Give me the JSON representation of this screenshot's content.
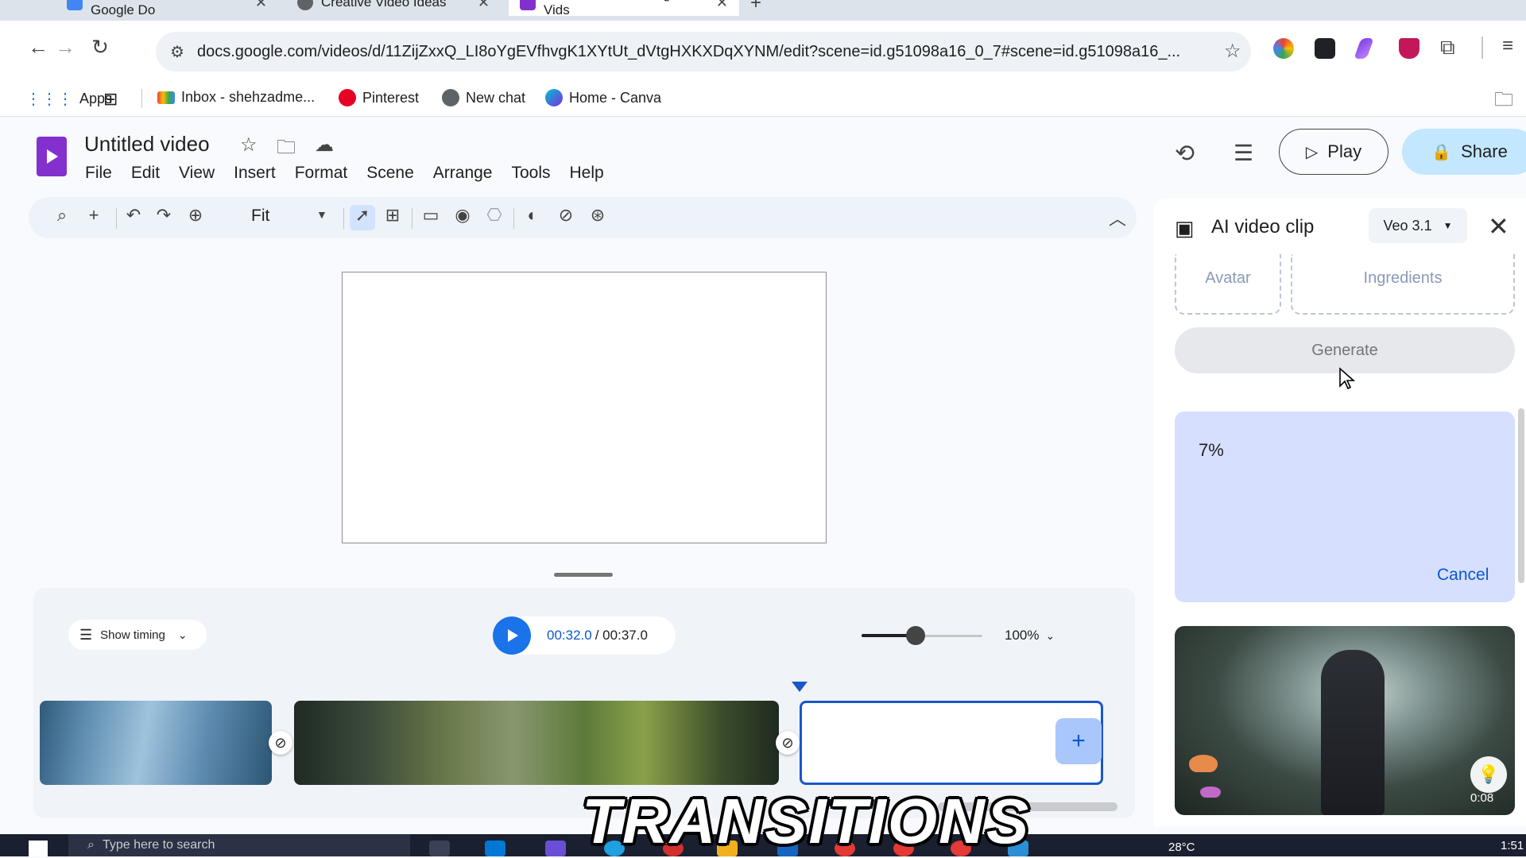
{
  "browser": {
    "tabs": [
      {
        "label": "Untitled document - Google Do",
        "color": "#4285f4"
      },
      {
        "label": "Creative Video Ideas",
        "color": "#5f6368"
      },
      {
        "label": "Untitled video - Google Vids",
        "color": "#8430ce"
      }
    ],
    "url": "docs.google.com/videos/d/11ZijZxxQ_LI8oYgEVfhvgK1XYtUt_dVtgHXKXDqXYNM/edit?scene=id.g51098a16_0_7#scene=id.g51098a16_...",
    "bookmarks": [
      "Apps",
      "Inbox - shehzadme...",
      "Pinterest",
      "New chat",
      "Home - Canva"
    ]
  },
  "app": {
    "doc_title": "Untitled video",
    "menu": [
      "File",
      "Edit",
      "View",
      "Insert",
      "Format",
      "Scene",
      "Arrange",
      "Tools",
      "Help"
    ],
    "zoom_fit": "Fit",
    "play_label": "Play",
    "share_label": "Share"
  },
  "timeline": {
    "show_timing": "Show timing",
    "current_time": "00:32.0",
    "total_time": "/ 00:37.0",
    "zoom_percent": "100%",
    "zoom_level": 0.45
  },
  "panel": {
    "title": "AI video clip",
    "model": "Veo 3.1",
    "tab_avatar": "Avatar",
    "tab_ingredients": "Ingredients",
    "generate_label": "Generate",
    "progress_value": "7%",
    "cancel_label": "Cancel",
    "preview_duration": "0:08"
  },
  "taskbar": {
    "search_placeholder": "Type here to search",
    "weather": "28°C",
    "time": "1:51"
  },
  "caption": "TRANSITIONS",
  "colors": {
    "accent": "#1a73e8",
    "brand": "#8430ce",
    "selection": "#1a56c9"
  }
}
